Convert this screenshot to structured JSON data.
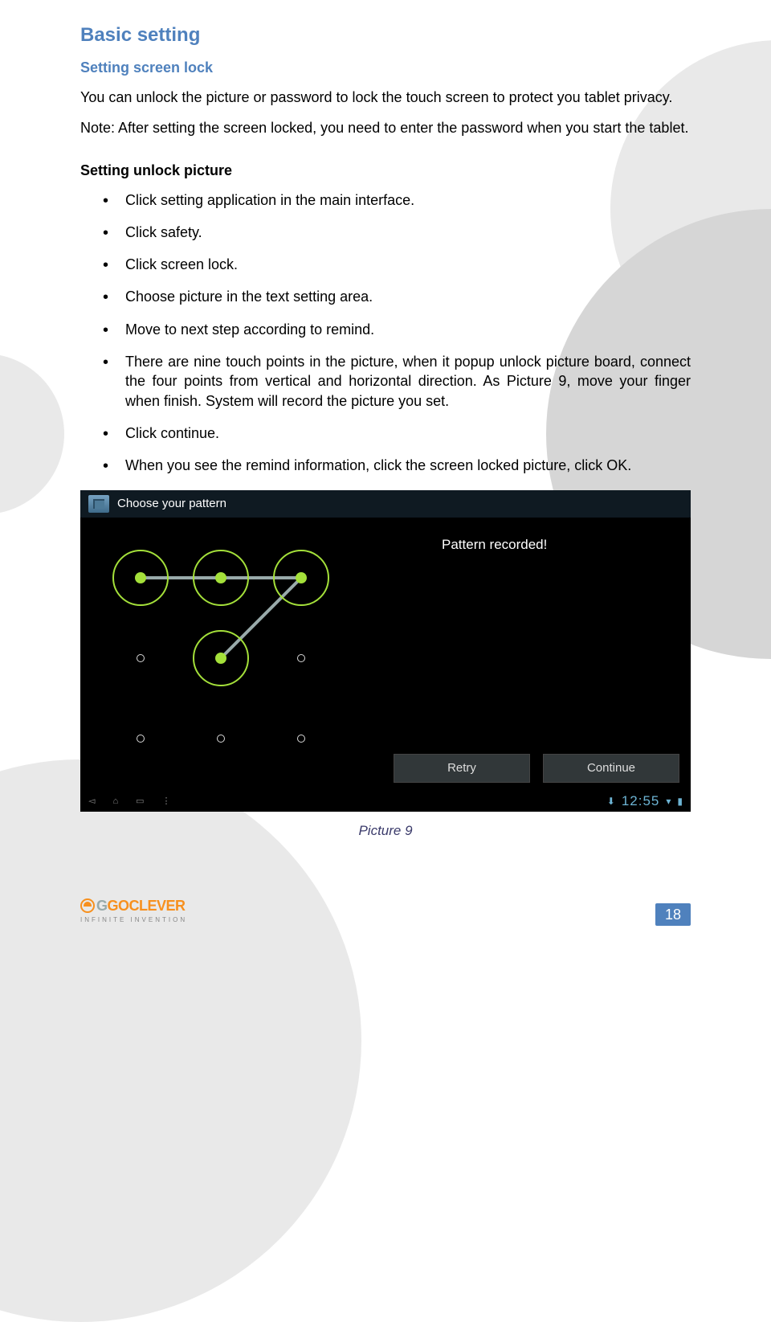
{
  "headings": {
    "main": "Basic setting",
    "sub1": "Setting screen lock",
    "sub2": "Setting unlock picture"
  },
  "paragraphs": {
    "intro": "You can unlock the picture or password to lock the touch screen to protect you tablet privacy.",
    "note": "Note: After setting the screen locked, you need to enter the password when you start the tablet."
  },
  "steps": [
    "Click setting application in the main interface.",
    "Click safety.",
    "Click screen lock.",
    "Choose picture in the text setting area.",
    "Move to next step according to remind.",
    "There are nine touch points in the picture, when it popup unlock picture board, connect the four points from vertical and horizontal direction. As Picture 9, move your finger when finish. System will record the picture you set.",
    "Click continue.",
    "When you see the remind information, click the screen locked picture, click OK."
  ],
  "screenshot": {
    "header": "Choose your pattern",
    "status": "Pattern recorded!",
    "btn_retry": "Retry",
    "btn_continue": "Continue",
    "clock": "12:55"
  },
  "caption": "Picture 9",
  "footer": {
    "brand": "GOCLEVER",
    "tagline": "INFINITE INVENTION",
    "page": "18"
  }
}
